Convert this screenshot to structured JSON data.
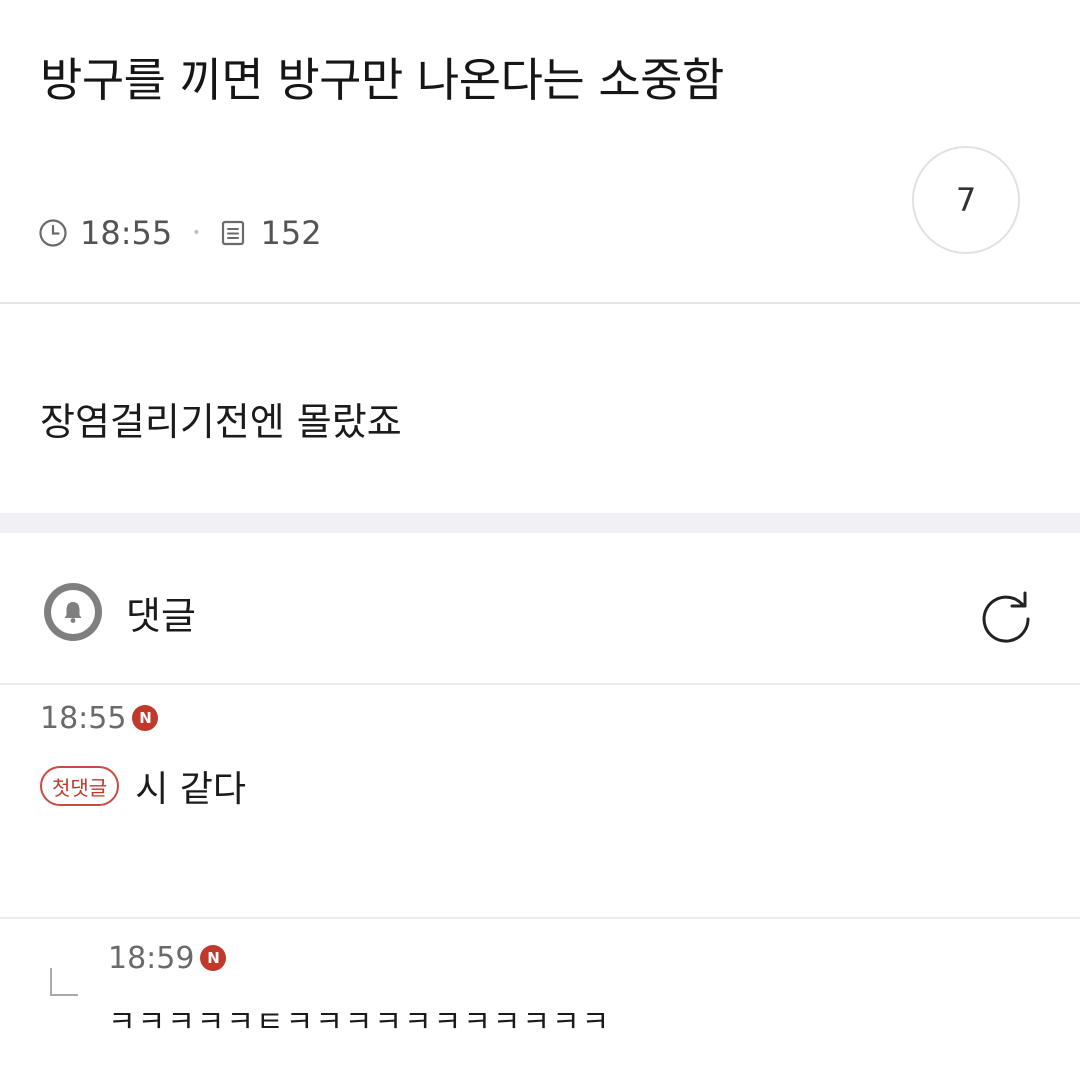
{
  "post": {
    "title": "방구를 끼면 방구만 나온다는 소중함",
    "time": "18:55",
    "views": "152",
    "comment_count": "7",
    "body": "장염걸리기전엔 몰랐죠"
  },
  "comments_section": {
    "label": "댓글",
    "icons": {
      "notify": "bell-icon",
      "refresh": "refresh-icon"
    }
  },
  "comments": [
    {
      "time": "18:55",
      "new_badge": "N",
      "tag": "첫댓글",
      "text": "시 같다"
    },
    {
      "time": "18:59",
      "new_badge": "N",
      "text": "ㅋㅋㅋㅋㅋㅌㅋㅋㅋㅋㅋㅋㅋㅋㅋㅋㅋ"
    }
  ],
  "colors": {
    "accent_red": "#c0392b",
    "meta_gray": "#545454",
    "band": "#f1f1f5"
  }
}
